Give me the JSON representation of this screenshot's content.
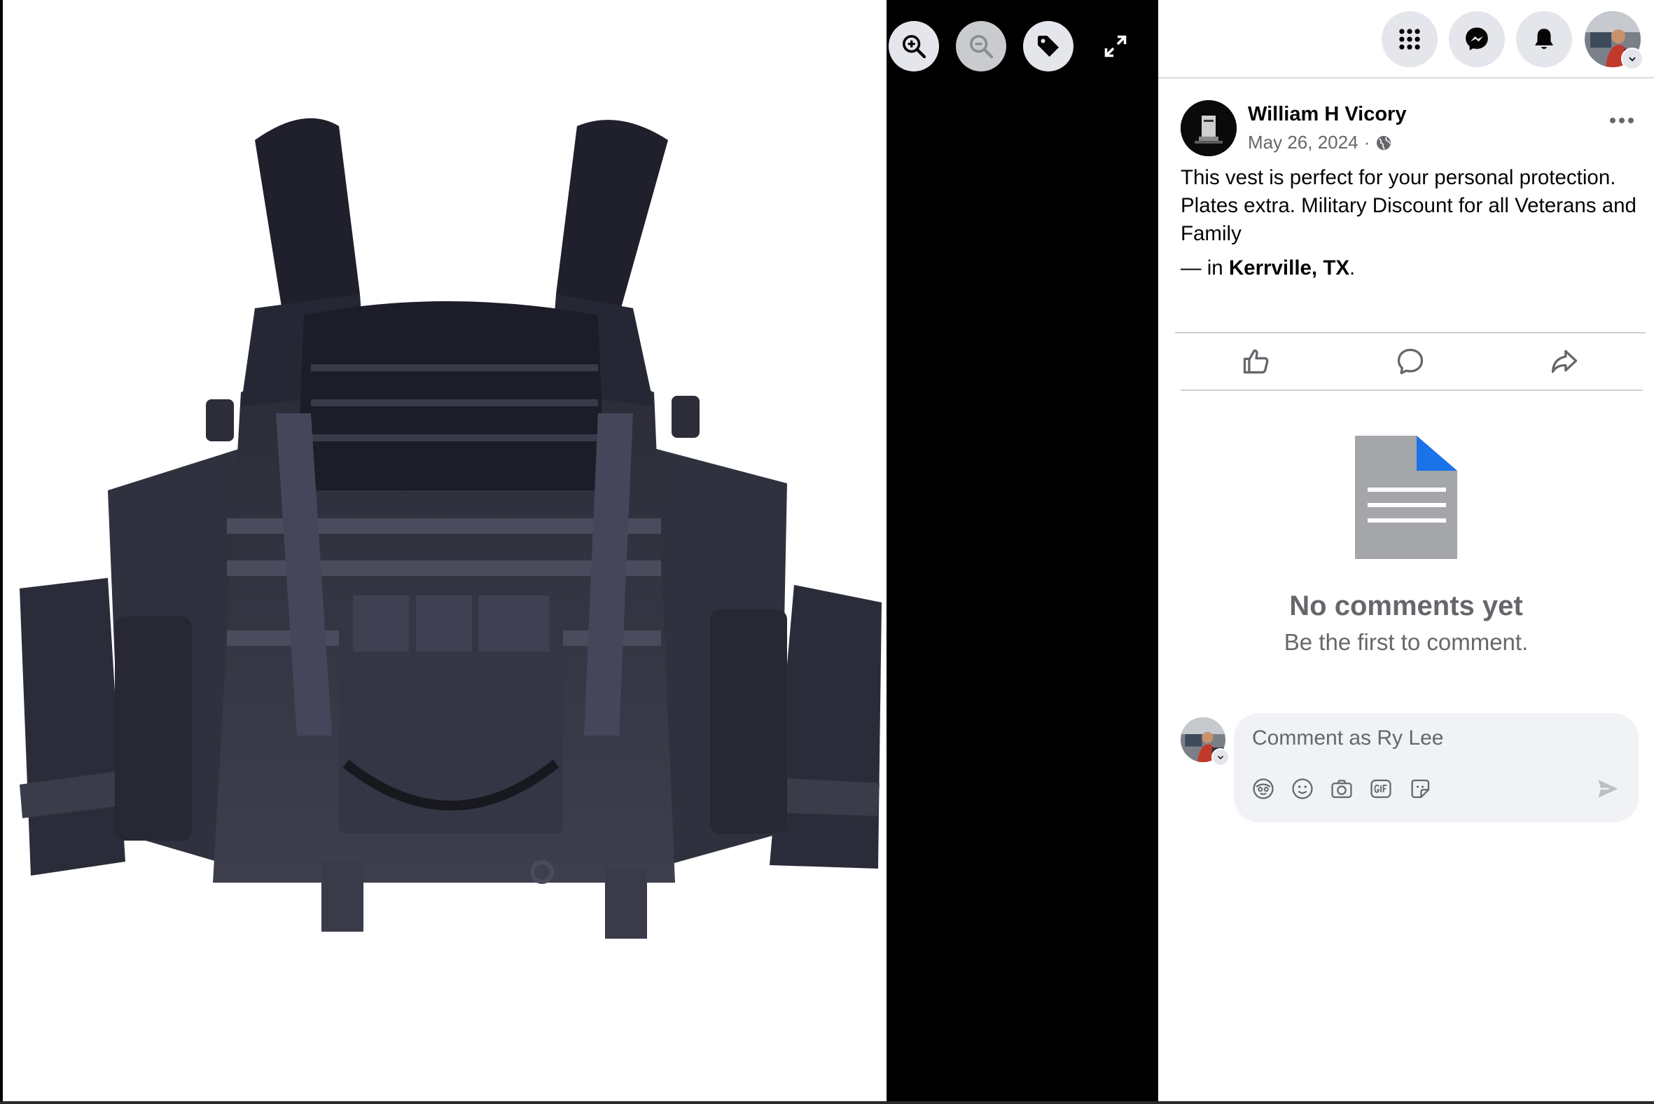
{
  "viewer": {
    "photo_subject": "black tactical plate carrier vest",
    "controls": [
      {
        "name": "zoom-in",
        "icon": "zoom-in-icon"
      },
      {
        "name": "zoom-out",
        "icon": "zoom-out-icon",
        "disabled": true
      },
      {
        "name": "tag",
        "icon": "tag-icon"
      },
      {
        "name": "fullscreen",
        "icon": "expand-icon"
      }
    ]
  },
  "topnav": {
    "menu_icon": "grid-menu-icon",
    "messenger_icon": "messenger-icon",
    "notifications_icon": "bell-icon",
    "account_icon": "profile-avatar"
  },
  "post": {
    "author": "William H Vicory",
    "date": "May 26, 2024",
    "separator": "·",
    "audience_icon": "globe-icon",
    "text": "This vest is perfect for your personal protection. Plates extra. Military Discount for all Veterans and Family",
    "location_prefix": "— in ",
    "location": "Kerrville, TX",
    "location_suffix": ".",
    "actions": [
      {
        "name": "like",
        "icon": "thumbs-up-icon"
      },
      {
        "name": "comment",
        "icon": "comment-bubble-icon"
      },
      {
        "name": "share",
        "icon": "share-arrow-icon"
      }
    ]
  },
  "comments": {
    "empty_title": "No comments yet",
    "empty_subtitle": "Be the first to comment.",
    "input_placeholder": "Comment as Ry Lee",
    "tools": [
      "avatar-sticker-icon",
      "emoji-icon",
      "camera-icon",
      "gif-icon",
      "sticker-icon"
    ],
    "send_icon": "send-icon"
  },
  "colors": {
    "text_primary": "#050505",
    "text_secondary": "#65676b",
    "button_bg": "#e4e6eb",
    "comment_bg": "#f0f2f5",
    "doc_gray": "#a4a6aa",
    "doc_blue": "#1a73e8"
  }
}
